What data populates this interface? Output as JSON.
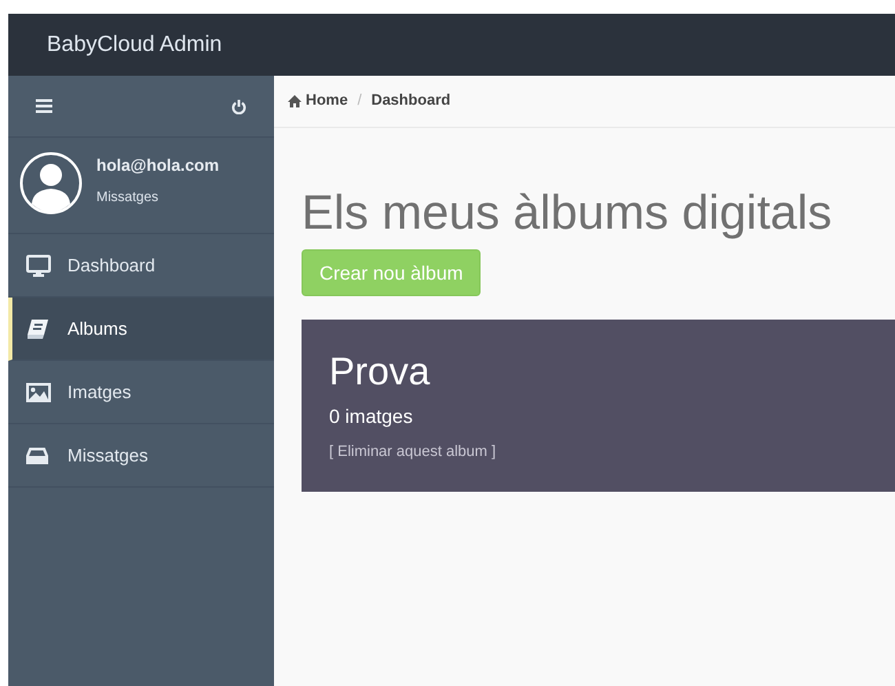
{
  "brand": "BabyCloud Admin",
  "user": {
    "email": "hola@hola.com",
    "link": "Missatges"
  },
  "nav": [
    {
      "label": "Dashboard",
      "selected": false
    },
    {
      "label": "Albums",
      "selected": true
    },
    {
      "label": "Imatges",
      "selected": false
    },
    {
      "label": "Missatges",
      "selected": false
    }
  ],
  "breadcrumb": [
    {
      "label": "Home"
    },
    {
      "separator": "/",
      "label": "Dashboard"
    }
  ],
  "heading": "Els meus àlbums digitals",
  "create_button": "Crear nou àlbum",
  "albums": [
    {
      "title": "Prova",
      "count": "0 imatges",
      "delete_link": "[ Eliminar aquest album ]"
    }
  ]
}
